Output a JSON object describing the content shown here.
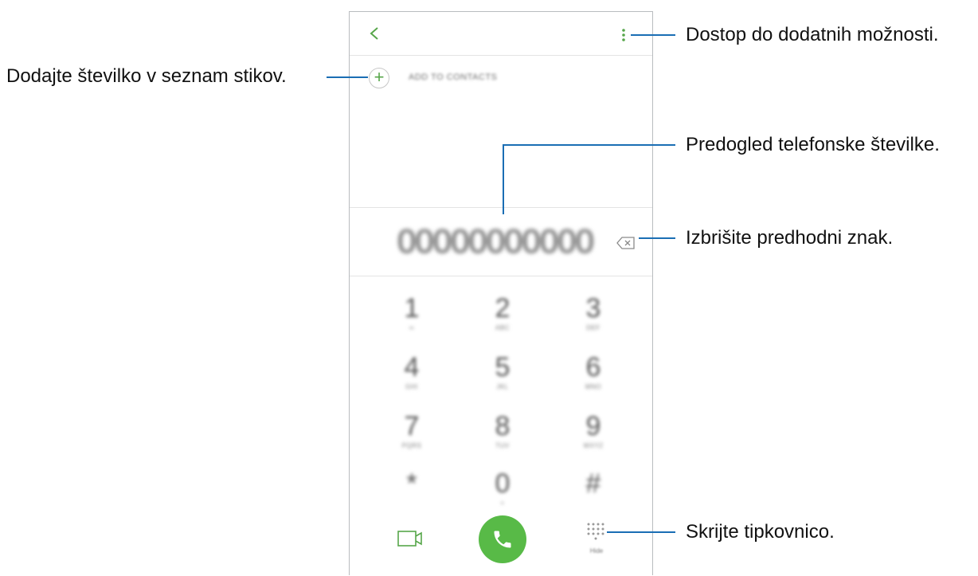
{
  "callouts": {
    "more_options": "Dostop do dodatnih možnosti.",
    "add_to_contacts": "Dodajte številko v seznam stikov.",
    "number_preview": "Predogled telefonske številke.",
    "delete_char": "Izbrišite predhodni znak.",
    "hide_keypad": "Skrijte tipkovnico."
  },
  "phone": {
    "add_to_contacts_label": "ADD TO CONTACTS",
    "number": "00000000000",
    "hide_label": "Hide",
    "keys": [
      {
        "digit": "1",
        "letters": "∞"
      },
      {
        "digit": "2",
        "letters": "ABC"
      },
      {
        "digit": "3",
        "letters": "DEF"
      },
      {
        "digit": "4",
        "letters": "GHI"
      },
      {
        "digit": "5",
        "letters": "JKL"
      },
      {
        "digit": "6",
        "letters": "MNO"
      },
      {
        "digit": "7",
        "letters": "PQRS"
      },
      {
        "digit": "8",
        "letters": "TUV"
      },
      {
        "digit": "9",
        "letters": "WXYZ"
      },
      {
        "digit": "*",
        "letters": ""
      },
      {
        "digit": "0",
        "letters": "+"
      },
      {
        "digit": "#",
        "letters": ""
      }
    ]
  },
  "colors": {
    "accent_green": "#58ba47",
    "callout_line": "#1a6eb4"
  },
  "icons": [
    "back-icon",
    "more-options-icon",
    "add-icon",
    "backspace-icon",
    "video-call-icon",
    "phone-icon",
    "keypad-icon"
  ]
}
